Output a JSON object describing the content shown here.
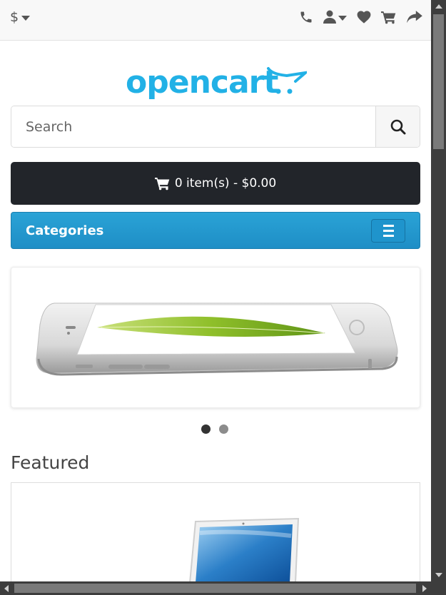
{
  "topbar": {
    "currency_symbol": "$",
    "icons": [
      "phone-icon",
      "user-icon",
      "heart-icon",
      "cart-icon",
      "share-icon"
    ]
  },
  "logo": {
    "text": "opencart"
  },
  "search": {
    "placeholder": "Search",
    "value": ""
  },
  "cart": {
    "label": "0 item(s) - $0.00"
  },
  "categories": {
    "label": "Categories"
  },
  "slider": {
    "image": "iphone-leaf-banner",
    "slide_count": 2,
    "active_slide": 1
  },
  "featured": {
    "title": "Featured",
    "first_product_image": "macbook-laptop"
  },
  "colors": {
    "brand_blue": "#2aa3d6",
    "dark": "#22252a",
    "topbar": "#f8f8f8"
  }
}
